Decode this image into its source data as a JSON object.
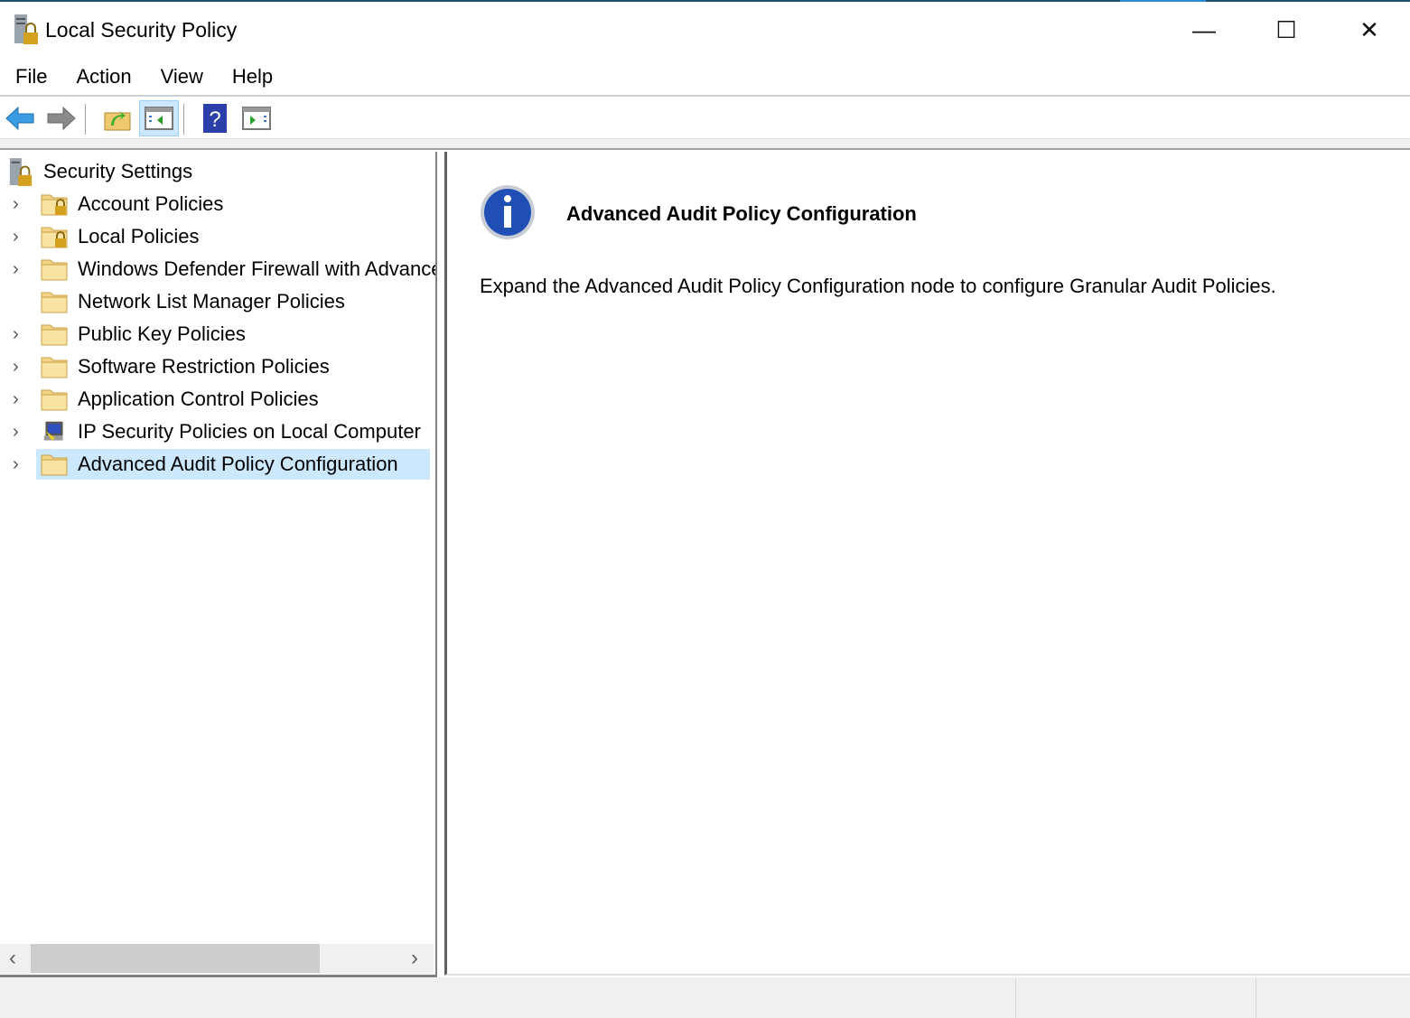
{
  "window": {
    "title": "Local Security Policy",
    "minimize": "—",
    "maximize": "☐",
    "close": "✕"
  },
  "menu": [
    "File",
    "Action",
    "View",
    "Help"
  ],
  "toolbar": {
    "icons": [
      "back-arrow-icon",
      "forward-arrow-icon",
      "up-folder-icon",
      "show-hide-console-tree-icon",
      "help-icon",
      "show-hide-action-pane-icon"
    ]
  },
  "tree": {
    "root": "Security Settings",
    "items": [
      {
        "label": "Account Policies",
        "expandable": true,
        "icon": "folder-lock"
      },
      {
        "label": "Local Policies",
        "expandable": true,
        "icon": "folder-lock"
      },
      {
        "label": "Windows Defender Firewall with Advanced Security",
        "expandable": true,
        "icon": "folder"
      },
      {
        "label": "Network List Manager Policies",
        "expandable": false,
        "icon": "folder"
      },
      {
        "label": "Public Key Policies",
        "expandable": true,
        "icon": "folder"
      },
      {
        "label": "Software Restriction Policies",
        "expandable": true,
        "icon": "folder"
      },
      {
        "label": "Application Control Policies",
        "expandable": true,
        "icon": "folder"
      },
      {
        "label": "IP Security Policies on Local Computer",
        "expandable": true,
        "icon": "ip-security"
      },
      {
        "label": "Advanced Audit Policy Configuration",
        "expandable": true,
        "icon": "folder",
        "selected": true
      }
    ]
  },
  "details": {
    "title": "Advanced Audit Policy Configuration",
    "description": "Expand the Advanced Audit Policy Configuration node to configure Granular Audit Policies."
  },
  "scrollbar": {
    "left": "‹",
    "right": "›"
  },
  "colors": {
    "selection": "#cce8ff",
    "info_blue": "#1f4fb4"
  }
}
